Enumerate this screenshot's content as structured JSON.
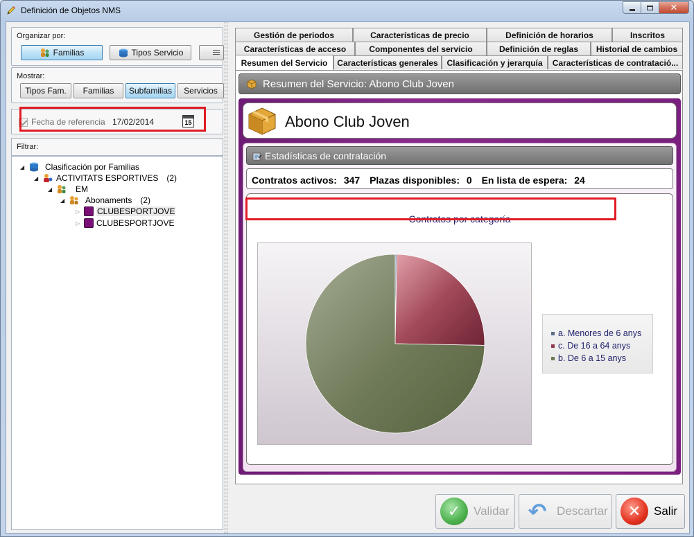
{
  "window": {
    "title": "Definición de Objetos NMS",
    "minimize_icon": "minimize-icon",
    "maximize_icon": "maximize-icon",
    "close_icon": "close-icon"
  },
  "left": {
    "organize_label": "Organizar por:",
    "organize_buttons": [
      {
        "label": "Familias",
        "icon": "families-icon",
        "active": true
      },
      {
        "label": "Tipos Servicio",
        "icon": "service-types-icon",
        "active": false
      },
      {
        "label": "",
        "icon": "list-icon",
        "active": false
      }
    ],
    "show_label": "Mostrar:",
    "show_buttons": [
      {
        "label": "Tipos Fam.",
        "active": false
      },
      {
        "label": "Familias",
        "active": false
      },
      {
        "label": "Subfamilias",
        "active": true
      },
      {
        "label": "Servicios",
        "active": false
      }
    ],
    "reference_date_label": "Fecha de referencia",
    "reference_date_value": "17/02/2014",
    "calendar_day": "15",
    "filter_label": "Filtrar:",
    "tree": [
      {
        "label": "Clasificación por Familias",
        "count": ""
      },
      {
        "label": "ACTIVITATS ESPORTIVES",
        "count": "(2)"
      },
      {
        "label": "EM",
        "count": ""
      },
      {
        "label": "Abonaments",
        "count": "(2)"
      },
      {
        "label": "CLUBESPORTJOVE",
        "count": ""
      },
      {
        "label": "CLUBESPORTJOVE",
        "count": ""
      }
    ]
  },
  "tabs": {
    "row1": [
      "Gestión de periodos",
      "Características de precio",
      "Definición de horarios",
      "Inscritos"
    ],
    "row2": [
      "Características de acceso",
      "Componentes del servicio",
      "Definición de reglas",
      "Historial de cambios"
    ],
    "row3": [
      "Resumen del Servicio",
      "Características generales",
      "Clasificación y jerarquía",
      "Características de contratació..."
    ]
  },
  "summary": {
    "header": "Resumen del Servicio: Abono Club Joven",
    "service_name": "Abono Club Joven",
    "stats_header": "Estadísticas de contratación",
    "active_label": "Contratos activos:",
    "active_value": "347",
    "places_label": "Plazas disponibles:",
    "places_value": "0",
    "waiting_label": "En lista de espera:",
    "waiting_value": "24"
  },
  "chart_data": {
    "type": "pie",
    "title": "Contratos por categoría",
    "categories": [
      "a. Menores de 6 anys",
      "c. De 16 a 64 anys",
      "b. De 6 a 15 anys"
    ],
    "values": [
      0.3,
      25,
      74.7
    ],
    "colors": [
      "#5a6f86",
      "#8f3a4a",
      "#6b7a58"
    ],
    "legend_position": "right"
  },
  "buttons": {
    "validate": "Validar",
    "discard": "Descartar",
    "exit": "Salir"
  }
}
